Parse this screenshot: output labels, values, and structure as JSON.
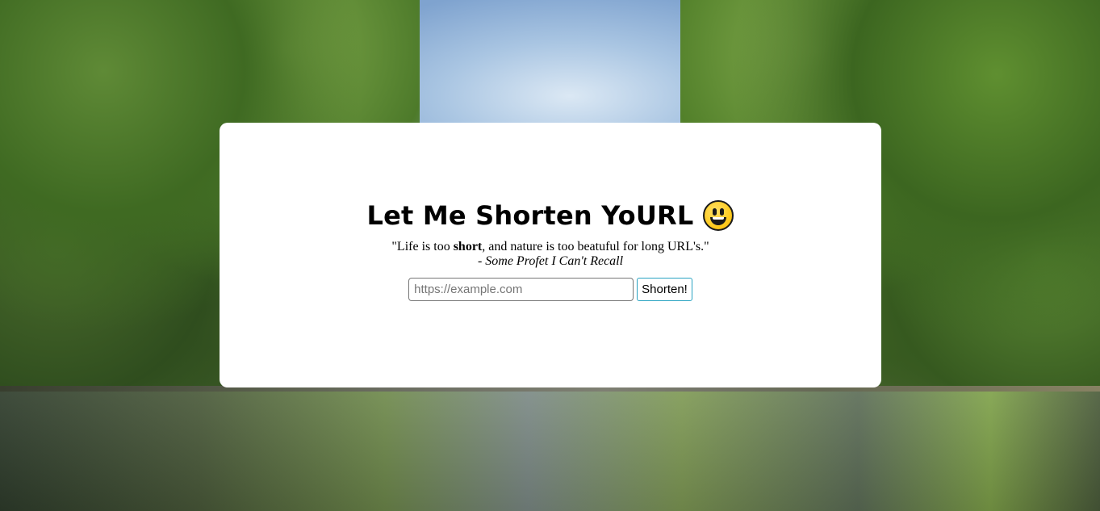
{
  "header": {
    "title": "Let Me Shorten YoURL",
    "emoji": "grinning-face-icon"
  },
  "quote": {
    "text_before": "\"Life is too ",
    "bold": "short",
    "text_after": ", and nature is too beatuful for long URL's.\"",
    "author": "- Some Profet I Can't Recall"
  },
  "form": {
    "url_placeholder": "https://example.com",
    "url_value": "",
    "submit_label": "Shorten!"
  },
  "colors": {
    "card_background": "#ffffff",
    "button_border": "#29a3c2",
    "input_border": "#767676"
  }
}
